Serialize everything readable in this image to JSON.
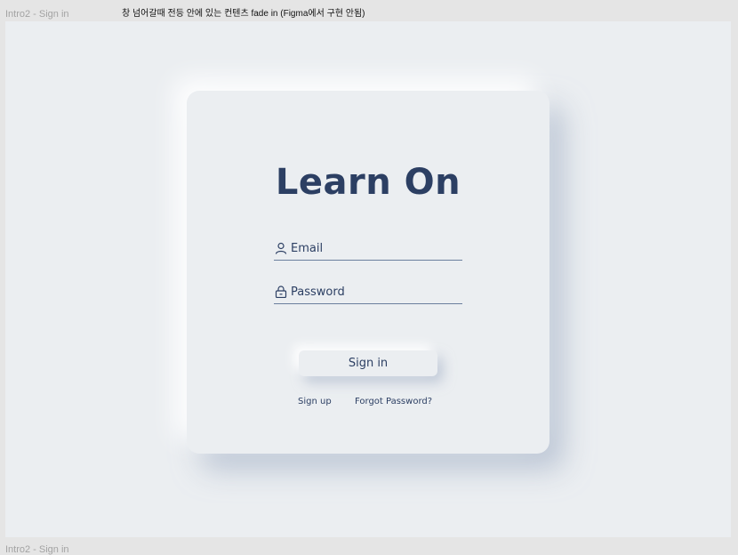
{
  "frame": {
    "label_top": "Intro2 - Sign in",
    "label_bottom": "Intro2 - Sign in",
    "annotation": "창 넘어갈때  전등 안에 있는 컨텐츠 fade in (Figma에서 구현 안됨)"
  },
  "login": {
    "title": "Learn On",
    "email": {
      "placeholder": "Email",
      "value": "",
      "icon": "user-icon"
    },
    "password": {
      "placeholder": "Password",
      "value": "",
      "icon": "lock-icon"
    },
    "signin_label": "Sign in",
    "signup_label": "Sign up",
    "forgot_label": "Forgot Password?"
  },
  "colors": {
    "background": "#ebeef1",
    "text": "#2c3f63",
    "underline": "#6b7f9e"
  }
}
